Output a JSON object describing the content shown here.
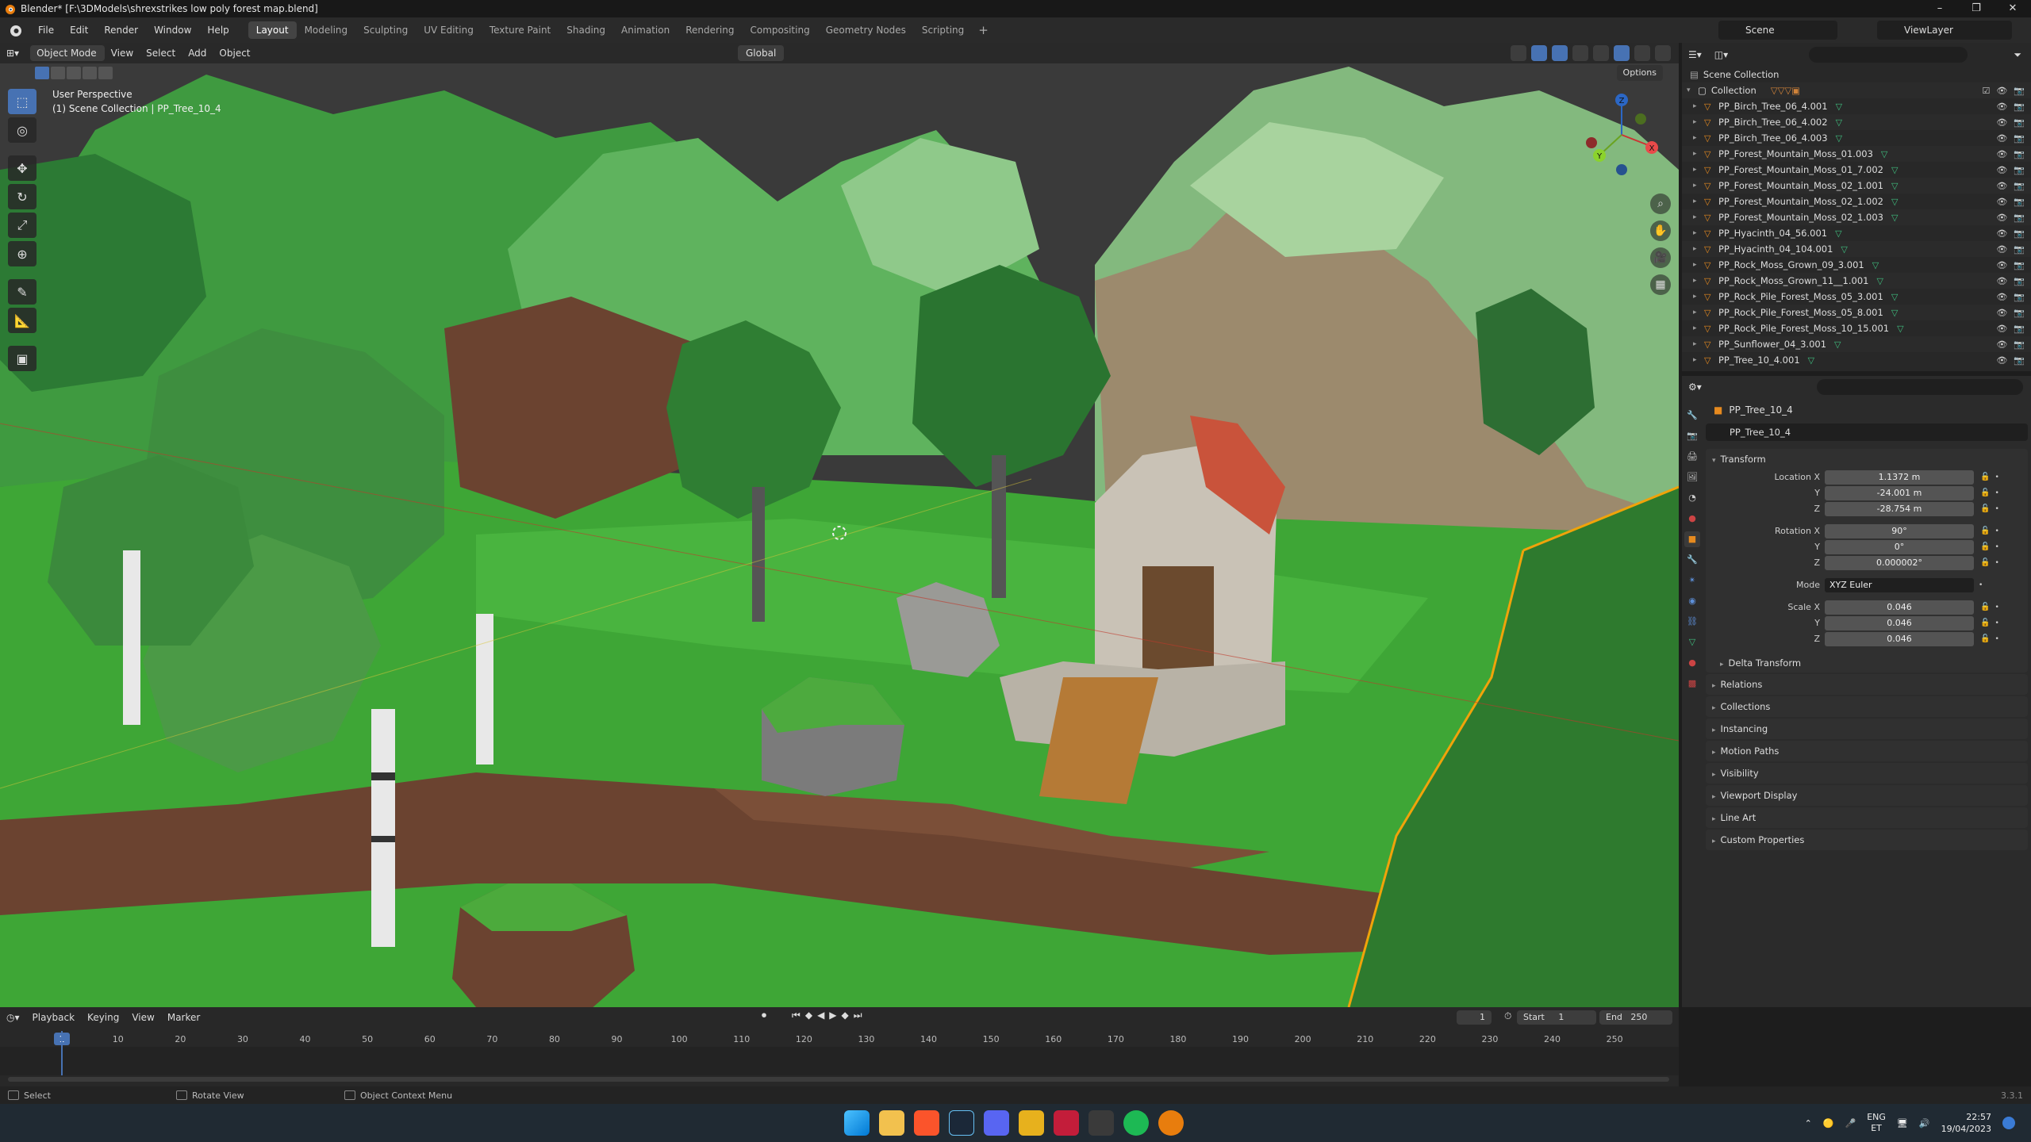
{
  "window": {
    "title": "Blender* [F:\\3DModels\\shrexstrikes low poly forest map.blend]",
    "controls": [
      "–",
      "❐",
      "✕"
    ]
  },
  "menu": {
    "items": [
      "File",
      "Edit",
      "Render",
      "Window",
      "Help"
    ],
    "workspaces": [
      "Layout",
      "Modeling",
      "Sculpting",
      "UV Editing",
      "Texture Paint",
      "Shading",
      "Animation",
      "Rendering",
      "Compositing",
      "Geometry Nodes",
      "Scripting"
    ],
    "active_workspace": "Layout",
    "add_tab": "+",
    "scene": "Scene",
    "view_layer": "ViewLayer"
  },
  "viewport": {
    "mode": "Object Mode",
    "header_menus": [
      "View",
      "Select",
      "Add",
      "Object"
    ],
    "orientation": "Global",
    "options": "Options",
    "info_line1": "User Perspective",
    "info_line2": "(1) Scene Collection | PP_Tree_10_4",
    "gizmo_axes": [
      "X",
      "Y",
      "Z"
    ]
  },
  "outliner": {
    "root": "Scene Collection",
    "collection": "Collection",
    "objects": [
      "PP_Birch_Tree_06_4.001",
      "PP_Birch_Tree_06_4.002",
      "PP_Birch_Tree_06_4.003",
      "PP_Forest_Mountain_Moss_01.003",
      "PP_Forest_Mountain_Moss_01_7.002",
      "PP_Forest_Mountain_Moss_02_1.001",
      "PP_Forest_Mountain_Moss_02_1.002",
      "PP_Forest_Mountain_Moss_02_1.003",
      "PP_Hyacinth_04_56.001",
      "PP_Hyacinth_04_104.001",
      "PP_Rock_Moss_Grown_09_3.001",
      "PP_Rock_Moss_Grown_11__1.001",
      "PP_Rock_Pile_Forest_Moss_05_3.001",
      "PP_Rock_Pile_Forest_Moss_05_8.001",
      "PP_Rock_Pile_Forest_Moss_10_15.001",
      "PP_Sunflower_04_3.001",
      "PP_Tree_10_4.001"
    ]
  },
  "properties": {
    "object_name": "PP_Tree_10_4",
    "data_name": "PP_Tree_10_4",
    "transform_label": "Transform",
    "location": {
      "label": "Location X",
      "x": "1.1372 m",
      "y": "-24.001 m",
      "z": "-28.754 m"
    },
    "rotation": {
      "label": "Rotation X",
      "x": "90°",
      "y": "0°",
      "z": "0.000002°"
    },
    "mode": {
      "label": "Mode",
      "value": "XYZ Euler"
    },
    "scale": {
      "label": "Scale X",
      "x": "0.046",
      "y": "0.046",
      "z": "0.046"
    },
    "axis_y": "Y",
    "axis_z": "Z",
    "delta_transform": "Delta Transform",
    "panels": [
      "Relations",
      "Collections",
      "Instancing",
      "Motion Paths",
      "Visibility",
      "Viewport Display",
      "Line Art",
      "Custom Properties"
    ]
  },
  "timeline": {
    "menus": [
      "Playback",
      "Keying",
      "View",
      "Marker"
    ],
    "current_frame": "1",
    "start_label": "Start",
    "start": "1",
    "end_label": "End",
    "end": "250",
    "ruler": [
      "1",
      "10",
      "20",
      "30",
      "40",
      "50",
      "60",
      "70",
      "80",
      "90",
      "100",
      "110",
      "120",
      "130",
      "140",
      "150",
      "160",
      "170",
      "180",
      "190",
      "200",
      "210",
      "220",
      "230",
      "240",
      "250"
    ]
  },
  "status": {
    "select": "Select",
    "rotate": "Rotate View",
    "context": "Object Context Menu",
    "version": "3.3.1"
  },
  "taskbar": {
    "lang1": "ENG",
    "lang2": "ET",
    "time": "22:57",
    "date": "19/04/2023"
  }
}
